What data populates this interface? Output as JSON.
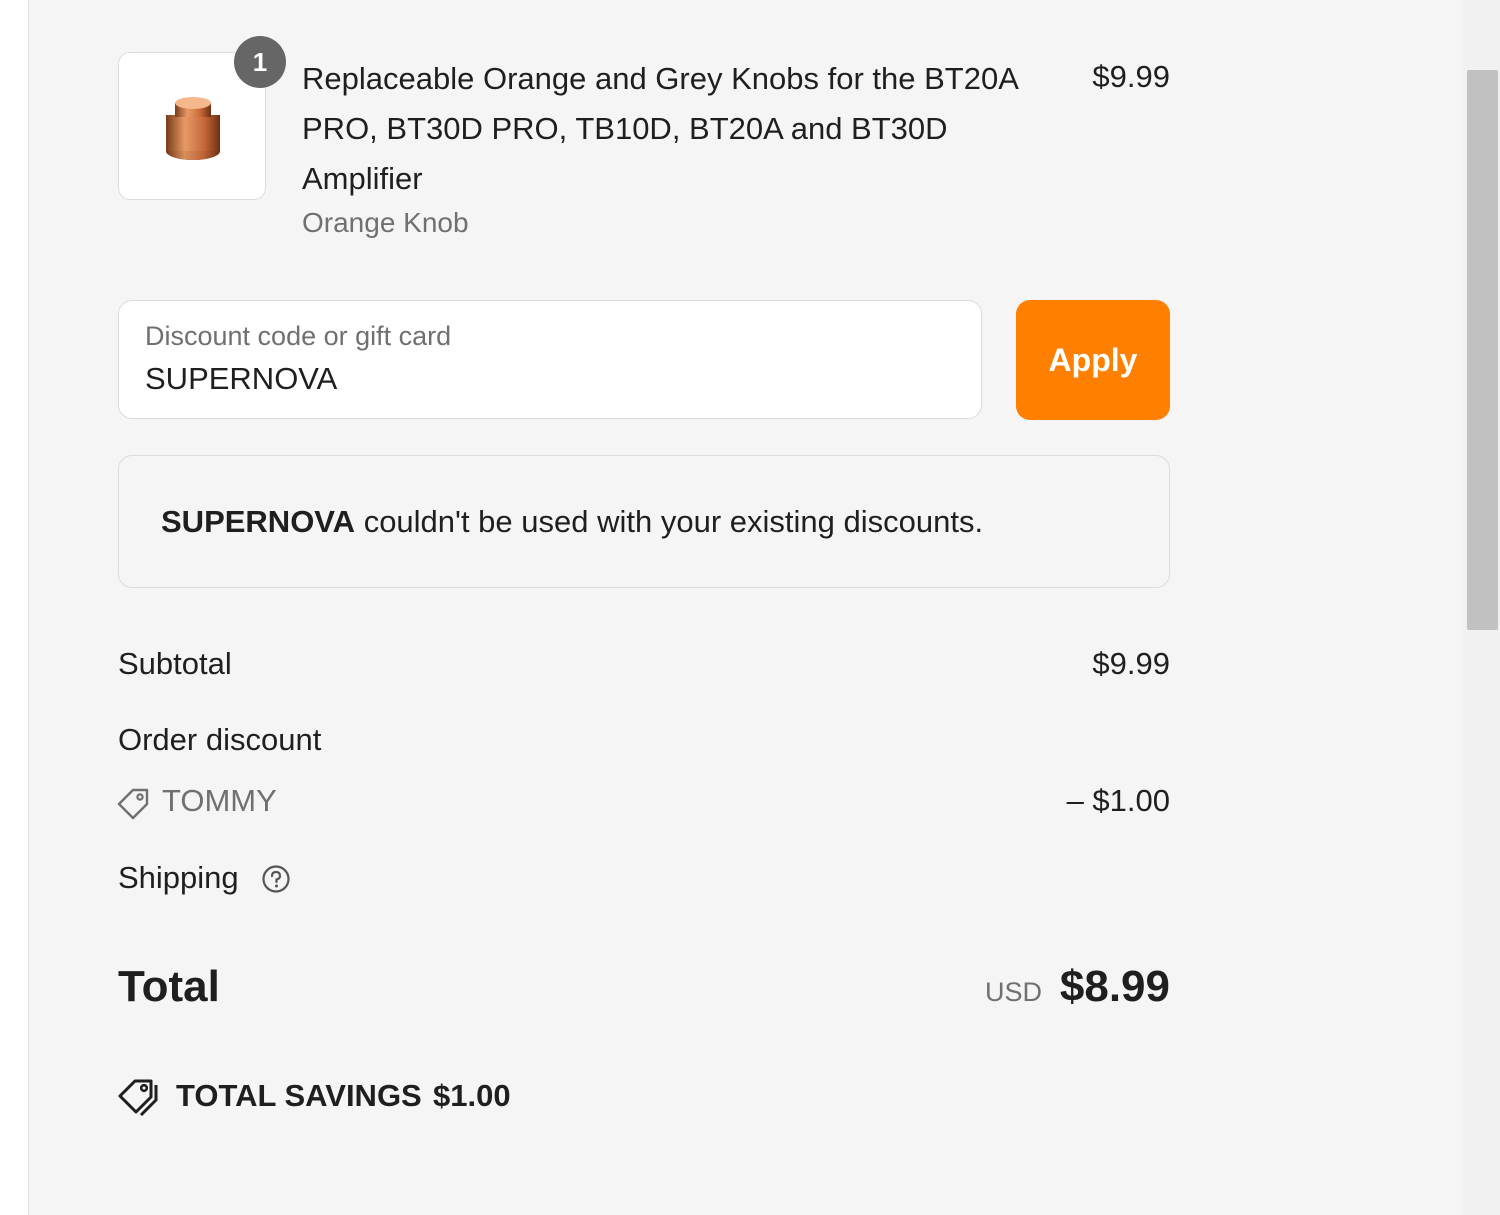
{
  "product": {
    "quantity": "1",
    "title": "Replaceable Orange and Grey Knobs for the BT20A PRO, BT30D PRO, TB10D, BT20A and BT30D Amplifier",
    "variant": "Orange Knob",
    "price": "$9.99",
    "image_icon": "orange-knob-image"
  },
  "discount": {
    "label": "Discount code or gift card",
    "value": "SUPERNOVA",
    "apply_label": "Apply",
    "apply_color": "#ff7f00"
  },
  "error": {
    "code": "SUPERNOVA",
    "message": " couldn't be used with your existing discounts."
  },
  "summary": {
    "subtotal_label": "Subtotal",
    "subtotal_value": "$9.99",
    "order_discount_label": "Order discount",
    "discount_code": "TOMMY",
    "discount_value": "– $1.00",
    "shipping_label": "Shipping",
    "total_label": "Total",
    "currency": "USD",
    "total_value": "$8.99",
    "savings_label": "TOTAL SAVINGS",
    "savings_value": "$1.00"
  }
}
